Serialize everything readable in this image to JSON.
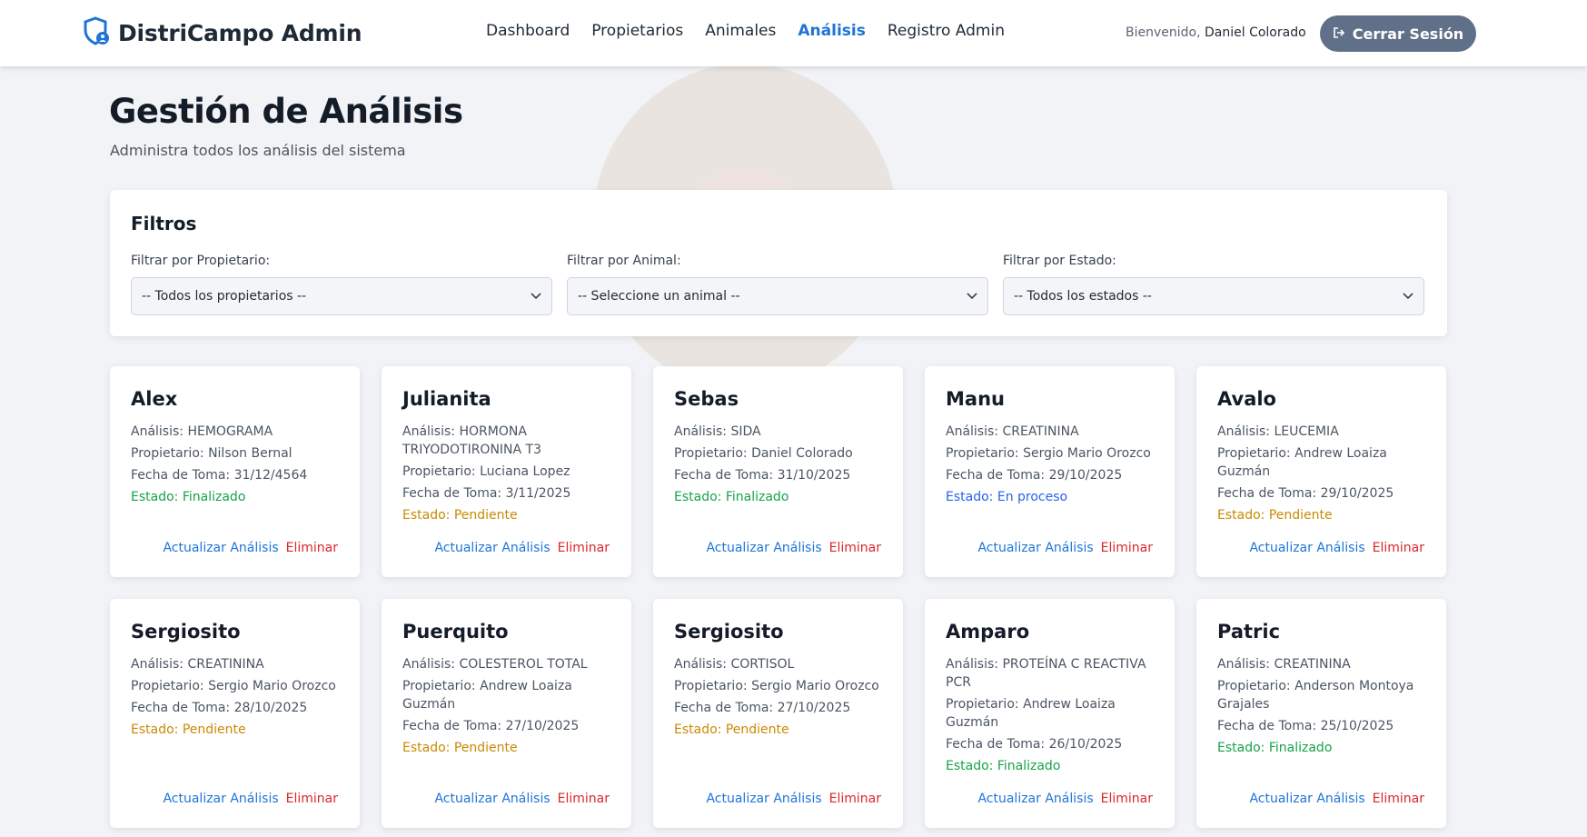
{
  "header": {
    "brand": "DistriCampo Admin",
    "nav": [
      "Dashboard",
      "Propietarios",
      "Animales",
      "Análisis",
      "Registro Admin"
    ],
    "active_nav": "Análisis",
    "welcome_prefix": "Bienvenido,",
    "user_name": "Daniel Colorado",
    "logout_label": "Cerrar Sesión"
  },
  "page": {
    "title": "Gestión de Análisis",
    "subtitle": "Administra todos los análisis del sistema"
  },
  "filters": {
    "title": "Filtros",
    "owner_label": "Filtrar por Propietario:",
    "owner_value": "-- Todos los propietarios --",
    "animal_label": "Filtrar por Animal:",
    "animal_value": "-- Seleccione un animal --",
    "status_label": "Filtrar por Estado:",
    "status_value": "-- Todos los estados --"
  },
  "labels": {
    "analysis": "Análisis:",
    "owner": "Propietario:",
    "date": "Fecha de Toma:",
    "status": "Estado:",
    "update": "Actualizar Análisis",
    "delete": "Eliminar"
  },
  "cards": [
    {
      "name": "Alex",
      "analysis": "HEMOGRAMA",
      "owner": "Nilson Bernal",
      "date": "31/12/4564",
      "status": "Finalizado"
    },
    {
      "name": "Julianita",
      "analysis": "HORMONA TRIYODOTIRONINA T3",
      "owner": "Luciana Lopez",
      "date": "3/11/2025",
      "status": "Pendiente"
    },
    {
      "name": "Sebas",
      "analysis": "SIDA",
      "owner": "Daniel Colorado",
      "date": "31/10/2025",
      "status": "Finalizado"
    },
    {
      "name": "Manu",
      "analysis": "CREATININA",
      "owner": "Sergio Mario Orozco",
      "date": "29/10/2025",
      "status": "En proceso"
    },
    {
      "name": "Avalo",
      "analysis": "LEUCEMIA",
      "owner": "Andrew Loaiza Guzmán",
      "date": "29/10/2025",
      "status": "Pendiente"
    },
    {
      "name": "Sergiosito",
      "analysis": "CREATININA",
      "owner": "Sergio Mario Orozco",
      "date": "28/10/2025",
      "status": "Pendiente"
    },
    {
      "name": "Puerquito",
      "analysis": "COLESTEROL TOTAL",
      "owner": "Andrew Loaiza Guzmán",
      "date": "27/10/2025",
      "status": "Pendiente"
    },
    {
      "name": "Sergiosito",
      "analysis": "CORTISOL",
      "owner": "Sergio Mario Orozco",
      "date": "27/10/2025",
      "status": "Pendiente"
    },
    {
      "name": "Amparo",
      "analysis": "PROTEÍNA C REACTIVA PCR",
      "owner": "Andrew Loaiza Guzmán",
      "date": "26/10/2025",
      "status": "Finalizado"
    },
    {
      "name": "Patric",
      "analysis": "CREATININA",
      "owner": "Anderson Montoya Grajales",
      "date": "25/10/2025",
      "status": "Finalizado"
    }
  ]
}
